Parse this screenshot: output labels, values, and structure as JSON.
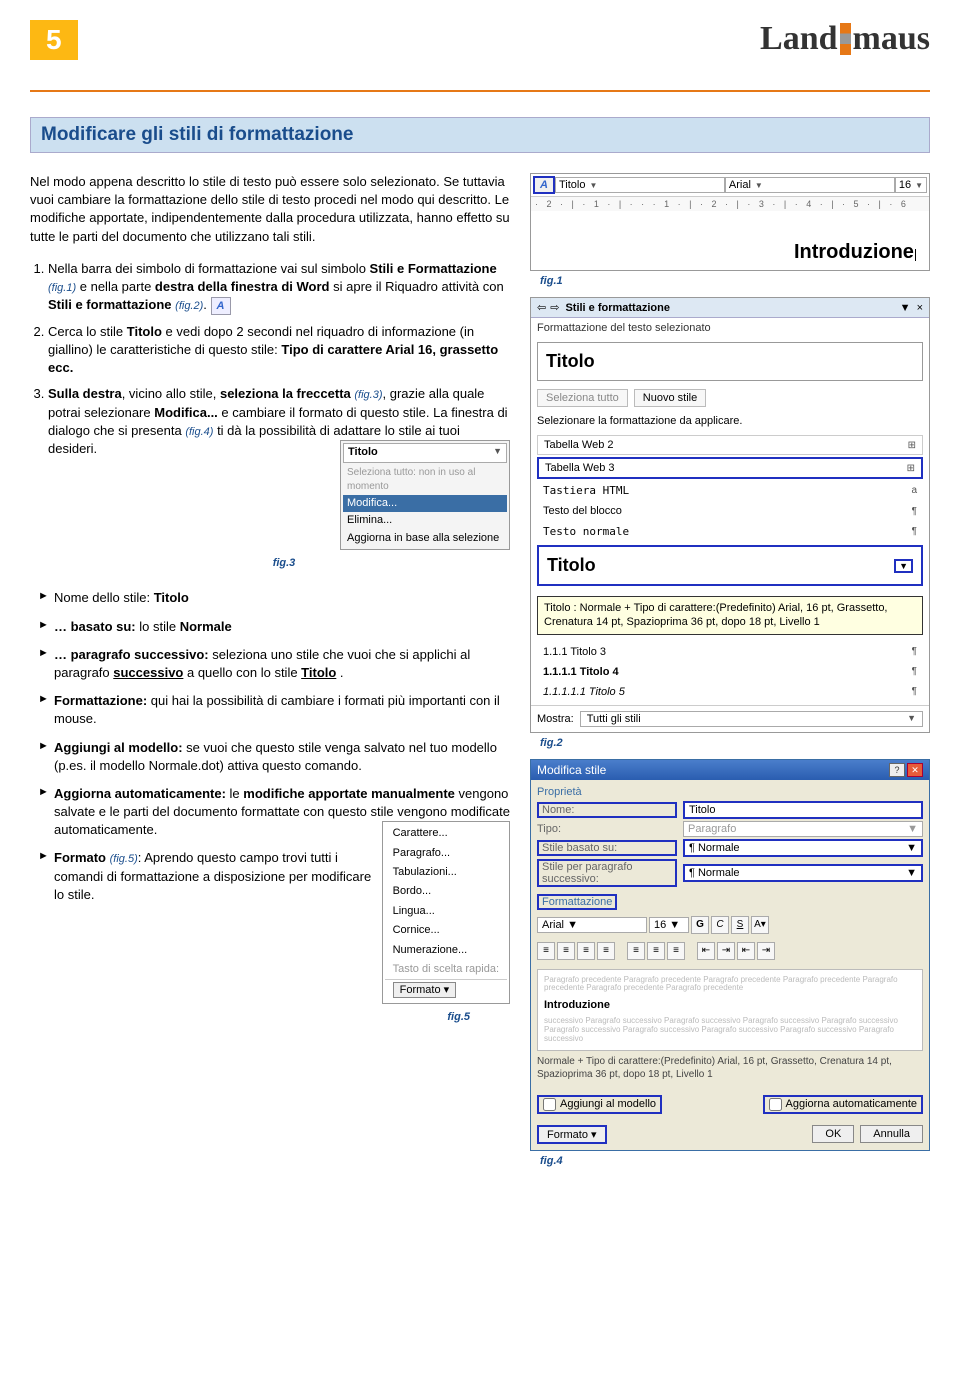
{
  "pagenum": "5",
  "logo": {
    "p1": "Land",
    "p2": "maus"
  },
  "section_title": "Modificare gli stili di formattazione",
  "intro": "Nel modo appena descritto lo stile di testo può essere solo selezionato. Se tuttavia vuoi cambiare la formattazione dello stile di testo procedi nel modo qui descritto. Le modifiche apportate, indipendentemente dalla procedura utilizzata, hanno effetto su tutte le parti del documento che utilizzano tali stili.",
  "steps": {
    "s1a": "Nella barra dei simbolo di formattazione vai sul simbolo ",
    "s1b": "Stili e Formattazione",
    "s1c": " e nella parte ",
    "s1d": "destra della finestra di Word",
    "s1e": " si apre il Riquadro attività con ",
    "s1f": "Stili e formattazione",
    "s1_fig1": "(fig.1)",
    "s1_fig2": "(fig.2)",
    "s1_end": ".",
    "s2a": "Cerca lo stile ",
    "s2b": "Titolo",
    "s2c": " e vedi dopo 2 secondi nel riquadro di informazione (in giallino) le caratteristiche di questo stile: ",
    "s2d": "Tipo di carattere Arial 16, grassetto ecc.",
    "s3a": "Sulla destra",
    "s3b": ", vicino allo stile, ",
    "s3c": "seleziona la freccetta",
    "s3d": ", grazie alla quale potrai selezionare ",
    "s3_fig": "(fig.3)",
    "s3e": "Modifica...",
    "s3f": " e cambiare il formato di questo stile. La finestra di dialogo che si presenta ",
    "s3_fig4": "(fig.4)",
    "s3g": " ti dà la possibilità di adattare lo stile ai tuoi desideri."
  },
  "fig3": {
    "title": "Titolo",
    "line1": "Seleziona tutto: non in uso al momento",
    "line2": "Modifica...",
    "line3": "Elimina...",
    "line4": "Aggiorna in base alla selezione",
    "label": "fig.3"
  },
  "bullets": {
    "b1a": "Nome dello stile: ",
    "b1b": "Titolo",
    "b2a": "… basato su: ",
    "b2b": "lo stile ",
    "b2c": "Normale",
    "b3a": "… paragrafo successivo: ",
    "b3b": "seleziona uno stile che vuoi che si applichi al paragrafo ",
    "b3c": "successivo",
    "b3d": " a quello con lo stile ",
    "b3e": "Titolo",
    "b3f": " .",
    "b4a": "Formattazione: ",
    "b4b": "qui hai la possibilità di cambiare i formati più importanti con il mouse.",
    "b5a": "Aggiungi al modello: ",
    "b5b": "se vuoi che questo stile venga salvato nel tuo modello (p.es. il modello Normale.dot) attiva questo comando.",
    "b6a": "Aggiorna automaticamente: ",
    "b6b": "le ",
    "b6c": "modifiche apportate manualmente",
    "b6d": " vengono salvate e le parti del documento formattate con questo stile vengono modificate automaticamente.",
    "b7a": "Formato ",
    "b7_fig": "(fig.5)",
    "b7b": ": Aprendo questo campo trovi tutti i comandi di formattazione a disposizione per modificare lo stile."
  },
  "fig5": {
    "items": [
      "Carattere...",
      "Paragrafo...",
      "Tabulazioni...",
      "Bordo...",
      "Lingua...",
      "Cornice...",
      "Numerazione...",
      "Tasto di scelta rapida:"
    ],
    "btn": "Formato ▾",
    "label": "fig.5"
  },
  "fig1": {
    "label": "fig.1",
    "icon": "A",
    "style": "Titolo",
    "font": "Arial",
    "size": "16",
    "ruler": "· 2 · | · 1 · | · · · 1 · | · 2 · | · 3 · | · 4 · | · 5 · | · 6",
    "doc": "Introduzione"
  },
  "fig2": {
    "label": "fig.2",
    "pane_title": "Stili e formattazione",
    "pane_sub": "Formattazione del testo selezionato",
    "current": "Titolo",
    "btn_selall": "Seleziona tutto",
    "btn_new": "Nuovo stile",
    "prompt": "Selezionare la formattazione da applicare.",
    "items": [
      {
        "t": "Tabella Web 2",
        "s": "⊞"
      },
      {
        "t": "Tabella Web 3",
        "s": "⊞"
      },
      {
        "t": "Tastiera HTML",
        "s": "a"
      },
      {
        "t": "Testo del blocco",
        "s": "¶"
      },
      {
        "t": "Testo normale",
        "s": "¶"
      }
    ],
    "sel": "Titolo",
    "tooltip": "Titolo : Normale + Tipo di carattere:(Predefinito) Arial, 16 pt, Grassetto, Crenatura 14 pt, Spazioprima 36 pt,  dopo 18 pt, Livello 1",
    "extra": [
      {
        "t": "1.1.1 Titolo 3",
        "s": "¶"
      },
      {
        "t": "1.1.1.1 Titolo 4",
        "s": "¶",
        "bold": true
      },
      {
        "t": "1.1.1.1.1 Titolo 5",
        "s": "¶",
        "ital": true
      }
    ],
    "mostra_lbl": "Mostra:",
    "mostra_val": "Tutti gli stili"
  },
  "fig4": {
    "label": "fig.4",
    "title": "Modifica stile",
    "grp": "Proprietà",
    "nome_l": "Nome:",
    "nome_v": "Titolo",
    "tipo_l": "Tipo:",
    "tipo_v": "Paragrafo",
    "base_l": "Stile basato su:",
    "base_v": "¶ Normale",
    "succ_l": "Stile per paragrafo successivo:",
    "succ_v": "¶ Normale",
    "fmt_l": "Formattazione",
    "font": "Arial",
    "size": "16",
    "preview_mid": "Introduzione",
    "desc": "Normale + Tipo di carattere:(Predefinito) Arial, 16 pt, Grassetto, Crenatura 14 pt, Spazioprima 36 pt, dopo 18 pt, Livello 1",
    "chk1": "Aggiungi al modello",
    "chk2": "Aggiorna automaticamente",
    "btn_fmt": "Formato ▾",
    "btn_ok": "OK",
    "btn_cancel": "Annulla"
  }
}
